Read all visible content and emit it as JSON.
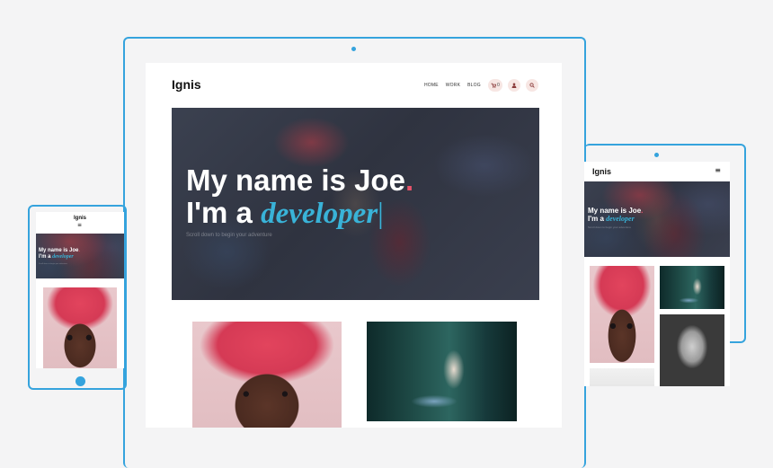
{
  "colors": {
    "frame": "#35a3dd",
    "hero_accent": "#39b3d8",
    "period_accent": "#e8546b",
    "pill_bg": "#f7e6e3",
    "page_bg": "#f4f4f5"
  },
  "brand": {
    "name": "Ignis"
  },
  "nav": {
    "links": [
      "HOME",
      "WORK",
      "BLOG"
    ],
    "cart_count": "0",
    "icons": [
      "cart-icon",
      "user-icon",
      "search-icon"
    ]
  },
  "hero": {
    "line1": "My name is Joe",
    "period": ".",
    "line2_prefix": "I'm a ",
    "role": "developer",
    "cursor": "|",
    "subtitle": "Scroll down to begin your adventure"
  },
  "mobile_menu_icon": "hamburger-icon",
  "menu_glyph": "≡"
}
